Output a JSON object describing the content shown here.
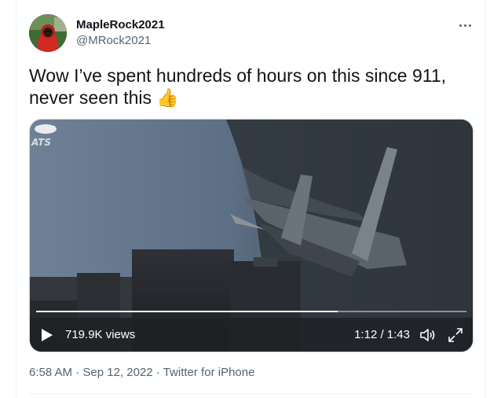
{
  "user": {
    "display_name": "MapleRock2021",
    "handle": "@MRock2021"
  },
  "tweet": {
    "text": "Wow I’ve spent hundreds of hours on this since 911, never seen this",
    "emoji": "👍"
  },
  "video": {
    "views": "719.9K views",
    "time": "1:12 / 1:43",
    "progress_fraction": 0.7,
    "watermark": "ATS"
  },
  "meta": {
    "time": "6:58 AM",
    "sep1": "·",
    "date": "Sep 12, 2022",
    "sep2": "·",
    "source": "Twitter for iPhone"
  },
  "icons": {
    "more": "more-horizontal-icon",
    "play": "play-icon",
    "volume": "volume-icon",
    "fullscreen": "fullscreen-icon"
  }
}
